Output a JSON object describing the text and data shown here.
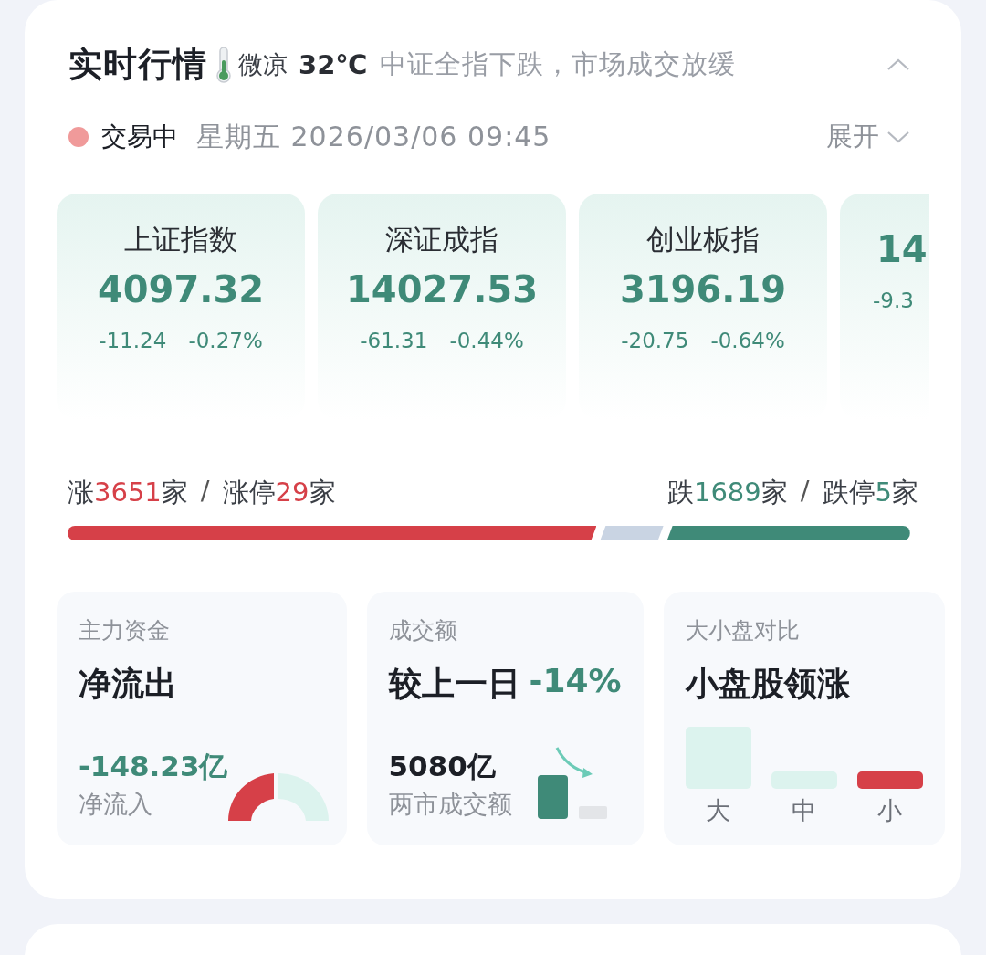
{
  "header": {
    "title": "实时行情",
    "weather": "微凉",
    "temperature": "32℃",
    "message": "中证全指下跌，市场成交放缓",
    "collapsed": false
  },
  "status": {
    "label": "交易中",
    "datetime": "星期五 2026/03/06 09:45",
    "expand": "展开"
  },
  "indices": [
    {
      "name": "上证指数",
      "value": "4097.32",
      "change": "-11.24",
      "percent": "-0.27%"
    },
    {
      "name": "深证成指",
      "value": "14027.53",
      "change": "-61.31",
      "percent": "-0.44%"
    },
    {
      "name": "创业板指",
      "value": "3196.19",
      "change": "-20.75",
      "percent": "-0.64%"
    },
    {
      "value": "14",
      "change": "-9.3"
    }
  ],
  "breadth": {
    "left": [
      {
        "prefix": "涨",
        "count": "3651",
        "suffix": "家"
      },
      {
        "prefix": "涨停",
        "count": "29",
        "suffix": "家"
      }
    ],
    "right": [
      {
        "prefix": "跌",
        "count": "1689",
        "suffix": "家"
      },
      {
        "prefix": "跌停",
        "count": "5",
        "suffix": "家"
      }
    ],
    "separator": "/",
    "segments": [
      {
        "kind": "up"
      },
      {
        "kind": "flat"
      },
      {
        "kind": "down"
      }
    ]
  },
  "panels": [
    {
      "kind": "flow",
      "label": "主力资金",
      "headline": "净流出",
      "value": "-148.23亿",
      "caption": "净流入"
    },
    {
      "kind": "volume",
      "label": "成交额",
      "headline": "较上一日",
      "headline_change": "-14%",
      "value": "5080亿",
      "caption": "两市成交额"
    },
    {
      "kind": "size",
      "label": "大小盘对比",
      "headline": "小盘股领涨",
      "bars": [
        {
          "label": "大",
          "color": "#dcf3ee"
        },
        {
          "label": "中",
          "color": "#dcf3ee"
        },
        {
          "label": "小",
          "color": "#d64048"
        }
      ]
    }
  ]
}
